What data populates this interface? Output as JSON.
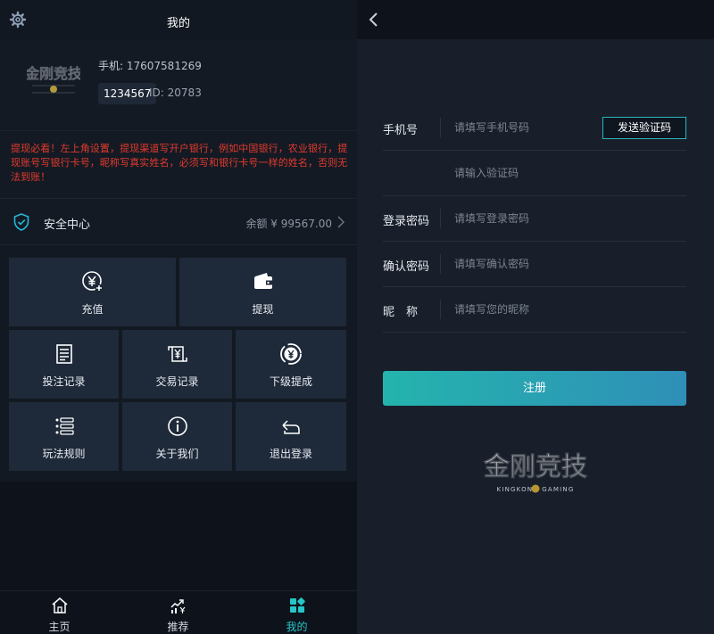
{
  "left": {
    "header": {
      "title": "我的",
      "settings_icon": "gear-icon"
    },
    "profile": {
      "logo_text": "金刚竞技",
      "phone_label": "手机:",
      "phone": "17607581269",
      "code": "1234567",
      "id_label": "ID:",
      "id": "20783"
    },
    "notice": "提现必看！左上角设置，提现渠道写开户银行，例如中国银行，农业银行，提现账号写银行卡号，昵称写真实姓名，必须写和银行卡号一样的姓名，否则无法到账！",
    "security": {
      "label": "安全中心",
      "balance_label": "余额 ¥",
      "balance": "99567.00",
      "icon": "shield-icon"
    },
    "tiles": [
      {
        "label": "充值",
        "icon": "recharge-icon"
      },
      {
        "label": "提现",
        "icon": "wallet-icon"
      },
      {
        "label": "投注记录",
        "icon": "document-icon"
      },
      {
        "label": "交易记录",
        "icon": "exchange-icon"
      },
      {
        "label": "下级提成",
        "icon": "commission-icon"
      },
      {
        "label": "玩法规则",
        "icon": "list-icon"
      },
      {
        "label": "关于我们",
        "icon": "info-icon"
      },
      {
        "label": "退出登录",
        "icon": "logout-icon"
      }
    ],
    "tabbar": [
      {
        "label": "主页",
        "icon": "home-icon",
        "active": false
      },
      {
        "label": "推荐",
        "icon": "trend-icon",
        "active": false
      },
      {
        "label": "我的",
        "icon": "grid-icon",
        "active": true
      }
    ]
  },
  "right": {
    "form": {
      "phone": {
        "label": "手机号",
        "placeholder": "请填写手机号码"
      },
      "send_code": "发送验证码",
      "code": {
        "label": "",
        "placeholder": "请输入验证码"
      },
      "password": {
        "label": "登录密码",
        "placeholder": "请填写登录密码"
      },
      "confirm": {
        "label": "确认密码",
        "placeholder": "请填写确认密码"
      },
      "nickname": {
        "label": "昵　称",
        "placeholder": "请填写您的昵称"
      }
    },
    "register": "注册",
    "logo": {
      "title": "金刚竞技",
      "subtitle": "KINGKONG GAMING"
    }
  },
  "colors": {
    "accent": "#26c5c7",
    "notice": "#e23a2c",
    "tile": "#1e2939"
  }
}
